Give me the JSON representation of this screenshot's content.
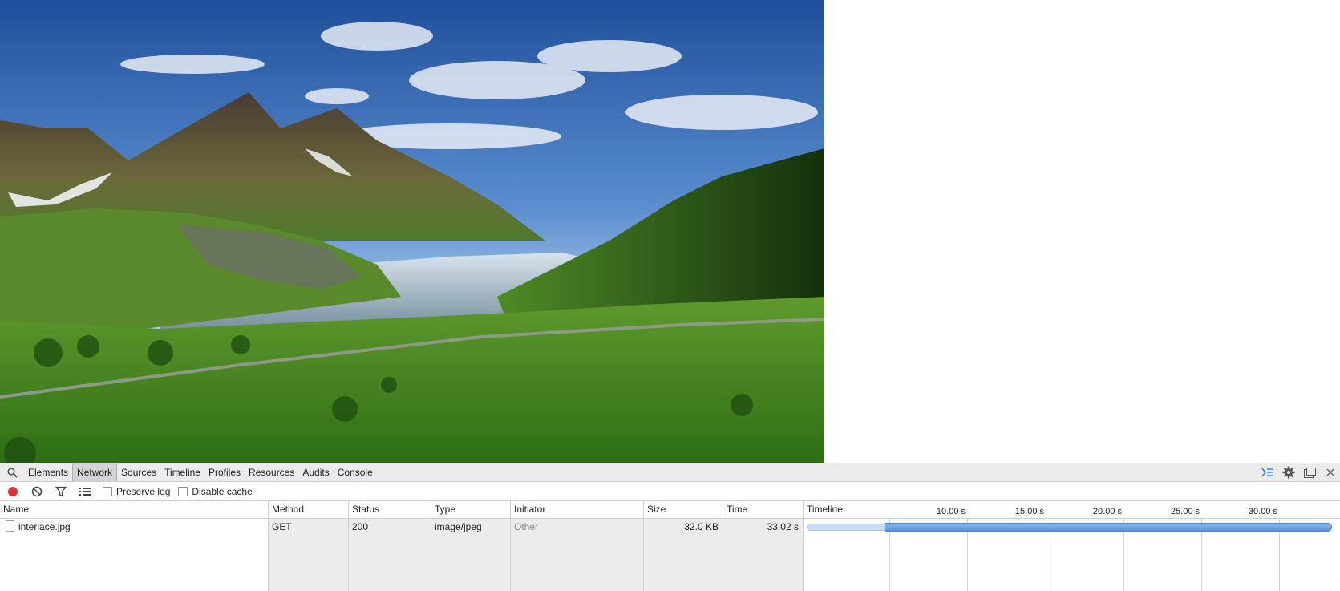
{
  "page": {
    "image_alt": "Mountain lake landscape (interlace.jpg)"
  },
  "devtools": {
    "tabs": [
      {
        "label": "Elements"
      },
      {
        "label": "Network",
        "active": true
      },
      {
        "label": "Sources"
      },
      {
        "label": "Timeline"
      },
      {
        "label": "Profiles"
      },
      {
        "label": "Resources"
      },
      {
        "label": "Audits"
      },
      {
        "label": "Console"
      }
    ],
    "icons": {
      "search": "search-icon",
      "drawer": "console-drawer-icon",
      "settings": "gear-icon",
      "dock": "dock-side-icon",
      "close": "close-icon"
    },
    "toolbar": {
      "record_color": "#e0312f",
      "preserve_log_label": "Preserve log",
      "preserve_log_checked": false,
      "disable_cache_label": "Disable cache",
      "disable_cache_checked": false
    },
    "columns": [
      "Name",
      "Method",
      "Status",
      "Type",
      "Initiator",
      "Size",
      "Time",
      "Timeline"
    ],
    "rows": [
      {
        "name": "interlace.jpg",
        "method": "GET",
        "status": "200",
        "type": "image/jpeg",
        "initiator": "Other",
        "size": "32.0 KB",
        "time": "33.02 s"
      }
    ],
    "timeline": {
      "ticks": [
        "10.00 s",
        "15.00 s",
        "20.00 s",
        "25.00 s",
        "30.00 s"
      ],
      "accent": "#5e93de"
    }
  }
}
